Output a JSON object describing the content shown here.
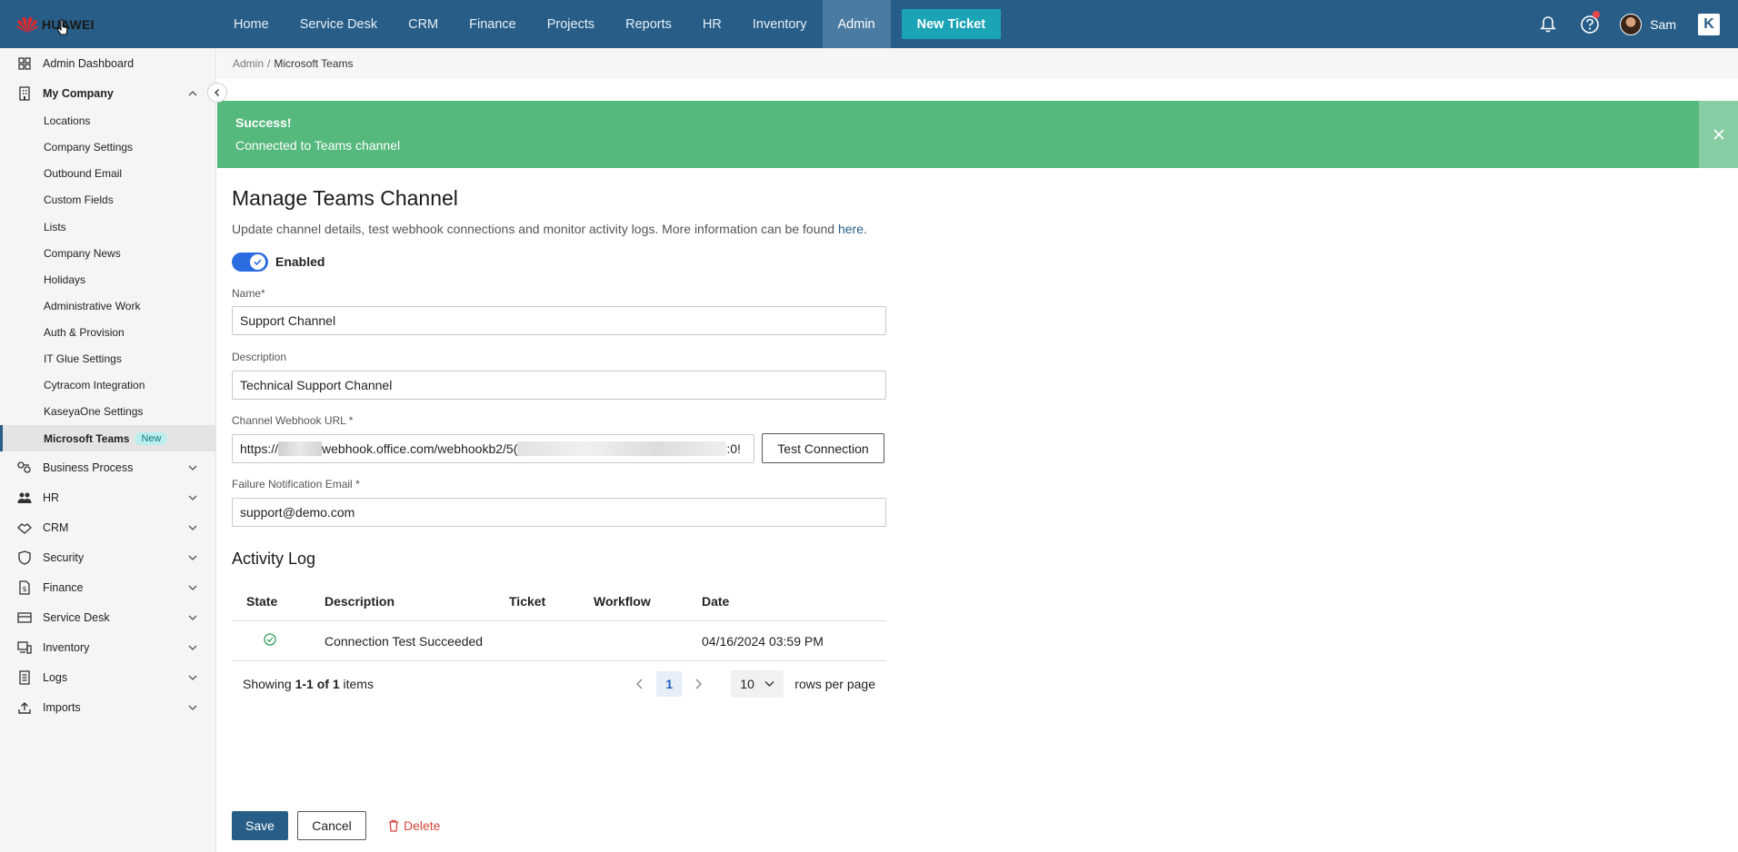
{
  "brand": {
    "name": "HUAWEI",
    "logo_color": "#e4262c"
  },
  "colors": {
    "topbar": "#275d87",
    "accent": "#1ba3b6",
    "success": "#55b87d",
    "danger": "#d6453d"
  },
  "topnav": {
    "items": [
      {
        "label": "Home"
      },
      {
        "label": "Service Desk"
      },
      {
        "label": "CRM"
      },
      {
        "label": "Finance"
      },
      {
        "label": "Projects"
      },
      {
        "label": "Reports"
      },
      {
        "label": "HR"
      },
      {
        "label": "Inventory"
      },
      {
        "label": "Admin",
        "active": true
      }
    ],
    "new_ticket_label": "New Ticket",
    "user_name": "Sam",
    "k_label": "K",
    "icons": [
      "bell-icon",
      "help-icon",
      "user-avatar",
      "kaseya-icon"
    ]
  },
  "sidebar": {
    "top_item": "Admin Dashboard",
    "my_company": "My Company",
    "sub_items": [
      "Locations",
      "Company Settings",
      "Outbound Email",
      "Custom Fields",
      "Lists",
      "Company News",
      "Holidays",
      "Administrative Work",
      "Auth & Provision",
      "IT Glue Settings",
      "Cytracom Integration",
      "KaseyaOne Settings",
      "Microsoft Teams"
    ],
    "new_badge": "New",
    "groups": [
      "Business Process",
      "HR",
      "CRM",
      "Security",
      "Finance",
      "Service Desk",
      "Inventory",
      "Logs",
      "Imports"
    ]
  },
  "breadcrumb": {
    "parent": "Admin",
    "separator": "/",
    "current": "Microsoft Teams"
  },
  "alert": {
    "title": "Success!",
    "message": "Connected to Teams channel"
  },
  "page": {
    "title": "Manage Teams Channel",
    "description": "Update channel details, test webhook connections and monitor activity logs. More information can be found",
    "link_text": "here.",
    "toggle_label": "Enabled",
    "toggle_on": true
  },
  "form": {
    "name_label": "Name",
    "name_value": "Support Channel",
    "description_label": "Description",
    "description_value": "Technical Support Channel",
    "webhook_label": "Channel Webhook URL",
    "webhook_prefix": "https://",
    "webhook_middle": "webhook.office.com/webhookb2/5(",
    "webhook_suffix": ":0!",
    "test_connection_label": "Test Connection",
    "email_label": "Failure Notification Email",
    "email_value": "support@demo.com",
    "required_mark": "*"
  },
  "activity_log": {
    "title": "Activity Log",
    "columns": [
      "State",
      "Description",
      "Ticket",
      "Workflow",
      "Date"
    ],
    "rows": [
      {
        "state": "success",
        "description": "Connection Test Succeeded",
        "ticket": "",
        "workflow": "",
        "date": "04/16/2024 03:59 PM"
      }
    ],
    "showing_prefix": "Showing",
    "showing_range": "1-1 of 1",
    "showing_suffix": "items",
    "current_page": "1",
    "page_size": "10",
    "rows_per_page_label": "rows per page"
  },
  "actions": {
    "save_label": "Save",
    "cancel_label": "Cancel",
    "delete_label": "Delete"
  }
}
